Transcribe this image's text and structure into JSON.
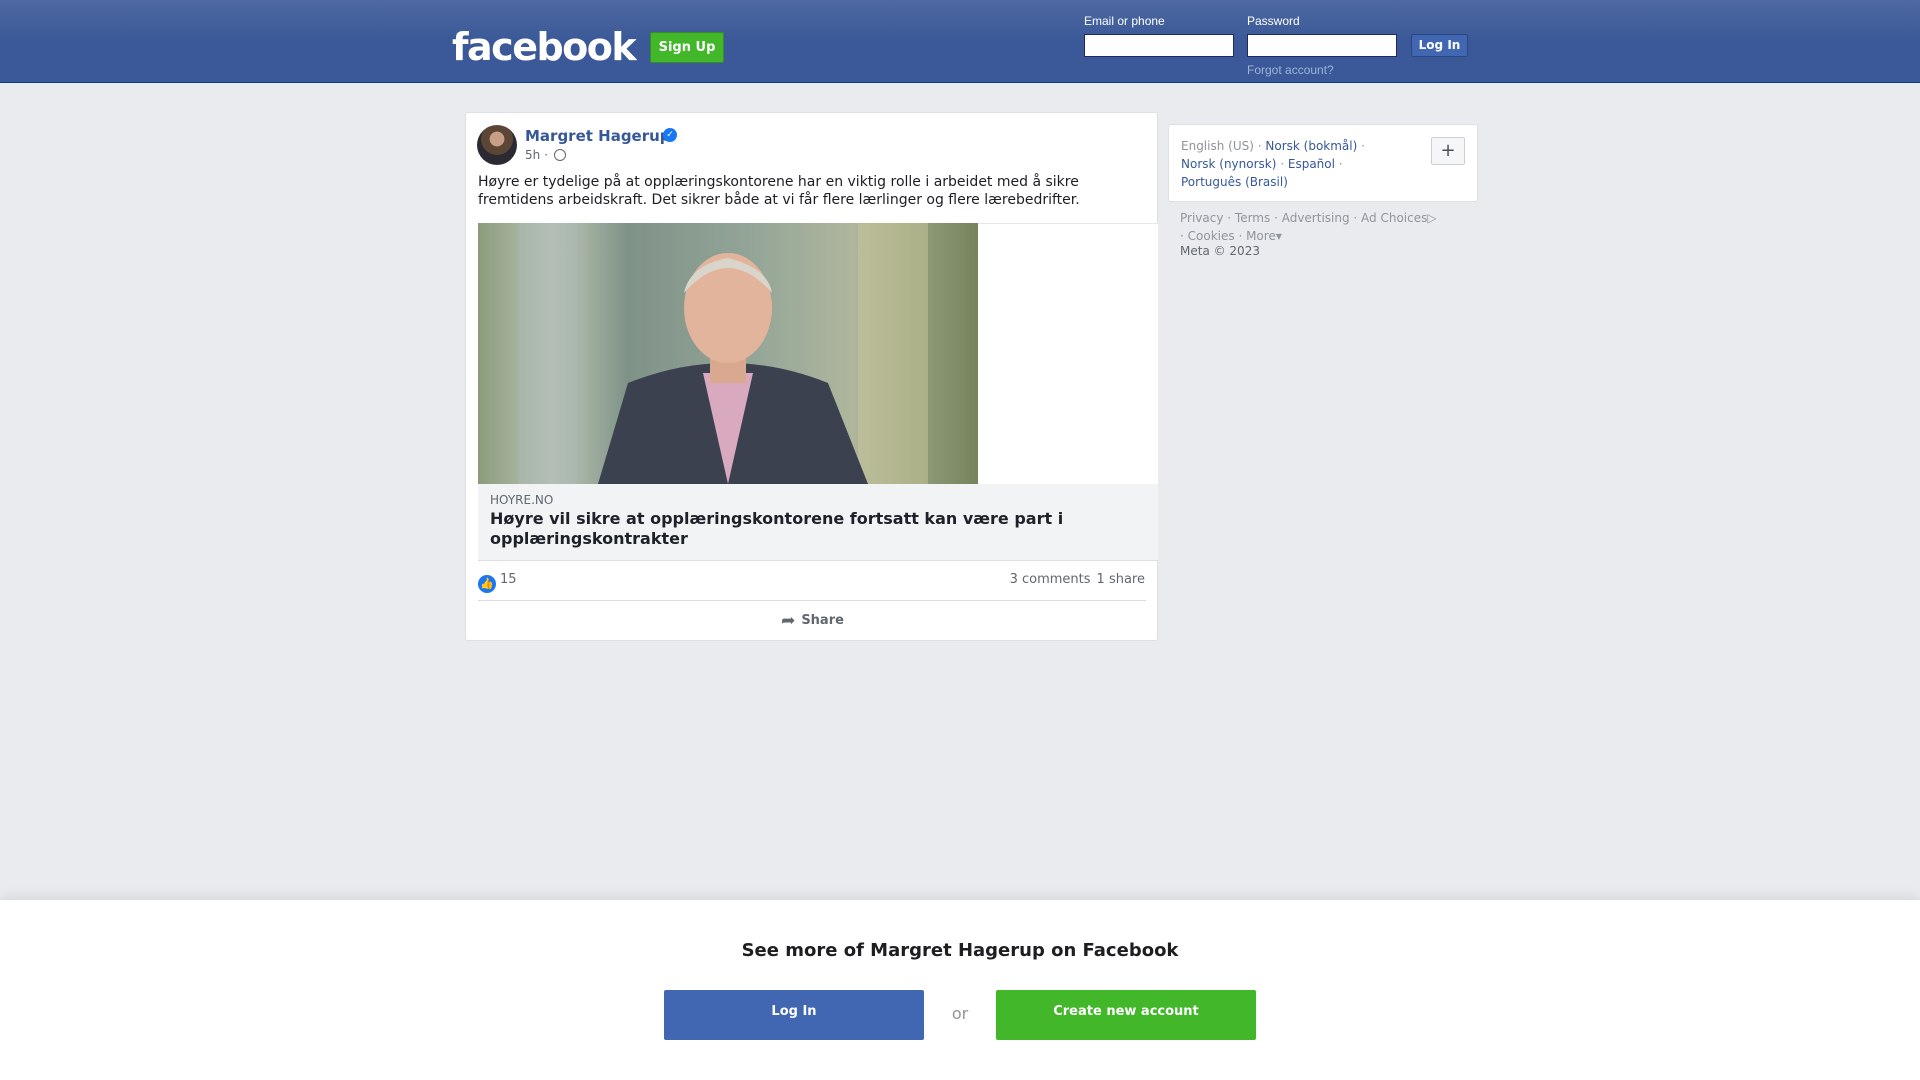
{
  "header": {
    "logo": "facebook",
    "signup_label": "Sign Up",
    "email_label": "Email or phone",
    "password_label": "Password",
    "login_label": "Log In",
    "forgot_label": "Forgot account?"
  },
  "post": {
    "author": "Margret Hagerup",
    "verified_icon": "verified-badge-icon",
    "time": "5h",
    "privacy_icon": "globe-icon",
    "text": "Høyre er tydelige på at opplæringskontorene har en viktig rolle i arbeidet med å sikre fremtidens arbeidskraft. Det sikrer både at vi får flere lærlinger og flere lærebedrifter.",
    "link": {
      "domain": "HOYRE.NO",
      "title": "Høyre vil sikre at opplæringskontorene fortsatt kan være part i opplæringskontrakter"
    },
    "reactions_count": "15",
    "comments": "3 comments",
    "shares": "1 share",
    "share_label": "Share"
  },
  "sidebar": {
    "current_language": "English (US)",
    "languages": [
      "Norsk (bokmål)",
      "Norsk (nynorsk)",
      "Español",
      "Português (Brasil)"
    ],
    "footer_links": [
      "Privacy",
      "Terms",
      "Advertising",
      "Ad Choices",
      "Cookies",
      "More"
    ],
    "copyright": "Meta © 2023"
  },
  "banner": {
    "title": "See more of Margret Hagerup on Facebook",
    "login_label": "Log In",
    "or_label": "or",
    "create_label": "Create new account"
  },
  "colors": {
    "brand": "#3b5998",
    "button_blue": "#4267b2",
    "button_green": "#42b72a",
    "like_blue": "#1877f2"
  }
}
